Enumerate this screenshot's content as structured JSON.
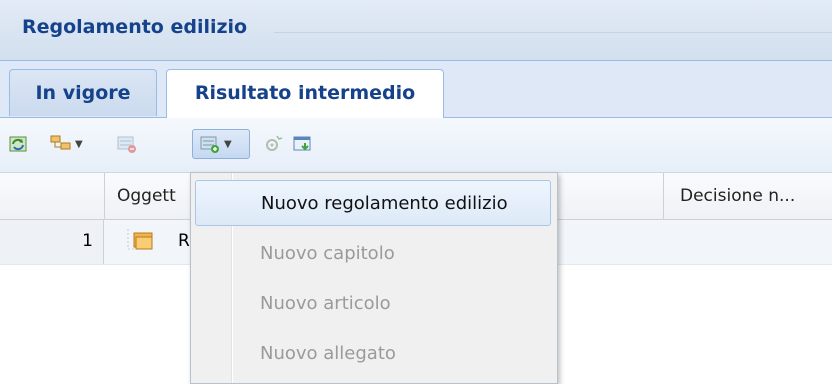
{
  "panel": {
    "title": "Regolamento edilizio"
  },
  "tabs": [
    {
      "label": "In vigore",
      "active": false
    },
    {
      "label": "Risultato intermedio",
      "active": true
    }
  ],
  "toolbar": {
    "buttons": [
      {
        "name": "refresh-icon"
      },
      {
        "name": "tree-structure-icon",
        "has_menu": true
      },
      {
        "name": "remove-item-icon"
      },
      {
        "name": "add-item-icon",
        "has_menu": true,
        "pressed": true
      },
      {
        "name": "settings-icon"
      },
      {
        "name": "import-icon"
      }
    ]
  },
  "grid": {
    "columns": {
      "object": "Oggett",
      "decision": "Decisione n..."
    },
    "rows": [
      {
        "number": "1",
        "label": "R"
      }
    ]
  },
  "menu": {
    "items": [
      {
        "label": "Nuovo regolamento edilizio",
        "enabled": true
      },
      {
        "label": "Nuovo capitolo",
        "enabled": false
      },
      {
        "label": "Nuovo articolo",
        "enabled": false
      },
      {
        "label": "Nuovo allegato",
        "enabled": false
      }
    ]
  },
  "colors": {
    "title": "#15428b",
    "header_bg": "#dfe8f6",
    "border": "#99bbe8"
  }
}
